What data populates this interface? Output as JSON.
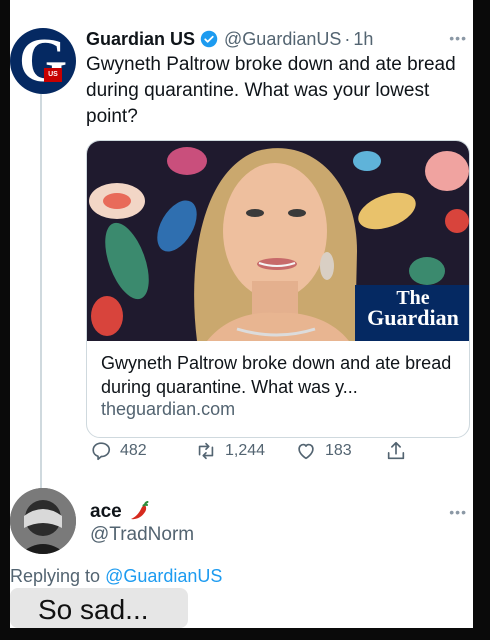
{
  "tweet": {
    "display_name": "Guardian US",
    "handle": "@GuardianUS",
    "separator": "·",
    "time": "1h",
    "avatar_badge": "US",
    "text": "Gwyneth Paltrow broke down and ate bread during quarantine. What was your lowest point?",
    "card": {
      "image_logo_line1": "The",
      "image_logo_line2": "Guardian",
      "title": "Gwyneth Paltrow broke down and ate bread during quarantine. What was y...",
      "domain": "theguardian.com"
    },
    "actions": {
      "replies": "482",
      "retweets": "1,244",
      "likes": "183"
    }
  },
  "reply": {
    "display_name": "ace",
    "handle": "@TradNorm",
    "replying_prefix": "Replying to ",
    "replying_to": "@GuardianUS"
  },
  "caption": "So sad...",
  "colors": {
    "guardian_navy": "#052962",
    "verified_blue": "#1d9bf0",
    "muted_gray": "#536471"
  }
}
